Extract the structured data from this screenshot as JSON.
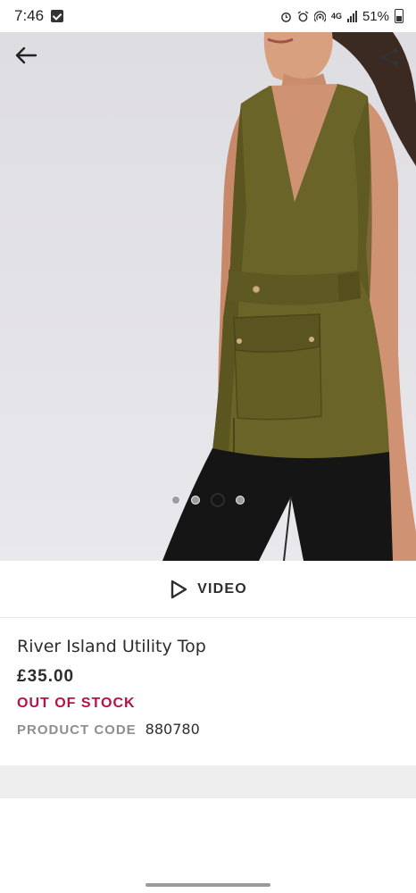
{
  "status_bar": {
    "time": "7:46",
    "battery_percent": "51%",
    "network": "4G"
  },
  "gallery": {
    "image_count": 4,
    "active_index": 2,
    "back_icon": "arrow-left-icon",
    "share_icon": "share-icon"
  },
  "video": {
    "label": "VIDEO",
    "icon": "play-icon"
  },
  "product": {
    "name": "River Island Utility Top",
    "price": "£35.00",
    "stock_status": "OUT OF STOCK",
    "code_label": "PRODUCT CODE",
    "code_value": "880780"
  },
  "colors": {
    "accent_stock": "#b4134a",
    "text": "#2d2d2d",
    "muted": "#8e8e8e"
  }
}
